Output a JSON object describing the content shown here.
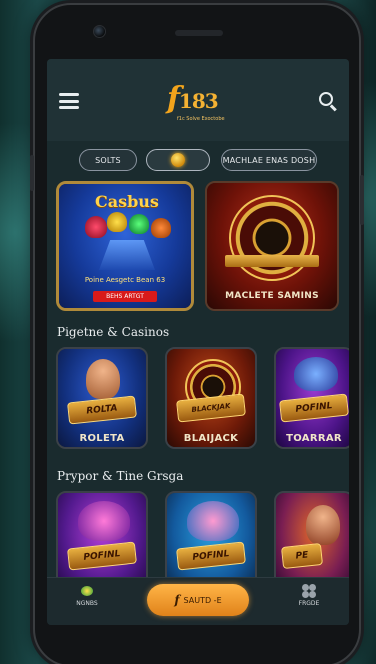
{
  "header": {
    "logo_main": "f",
    "logo_num": "183",
    "logo_sub": "f1c Solve Exoctobe"
  },
  "filters": [
    {
      "label": "SOLTS"
    },
    {
      "label": ""
    },
    {
      "label": "MACHLAE ENAS DOSH"
    }
  ],
  "banners": {
    "left": {
      "title": "Casbus",
      "subtitle": "Poine Aesgetc Bean 63",
      "cta": "BEHS ARTGT"
    },
    "right": {
      "label": "MACLETE SAMINS"
    }
  },
  "sections": [
    {
      "title": "Pigetne & Casinos",
      "tiles": [
        {
          "label": "ROLETA",
          "plate": "ROLTA"
        },
        {
          "label": "BLAIJACK",
          "plate": "BLACKJAK"
        },
        {
          "label": "TOARRAR",
          "plate": "POFINL"
        }
      ]
    },
    {
      "title": "Prypor & Tine Grsga",
      "tiles": [
        {
          "plate": "POFINL"
        },
        {
          "plate": "POFINL"
        },
        {
          "plate": "PE"
        }
      ]
    }
  ],
  "bottom_nav": {
    "left_label": "NGNBS",
    "center_label": "SAUTD -E",
    "center_glyph": "f",
    "right_label": "FRGDE"
  },
  "colors": {
    "accent": "#f2a41c",
    "banner_red": "#d81a1a",
    "screen_bg": "#1a2b2e"
  }
}
